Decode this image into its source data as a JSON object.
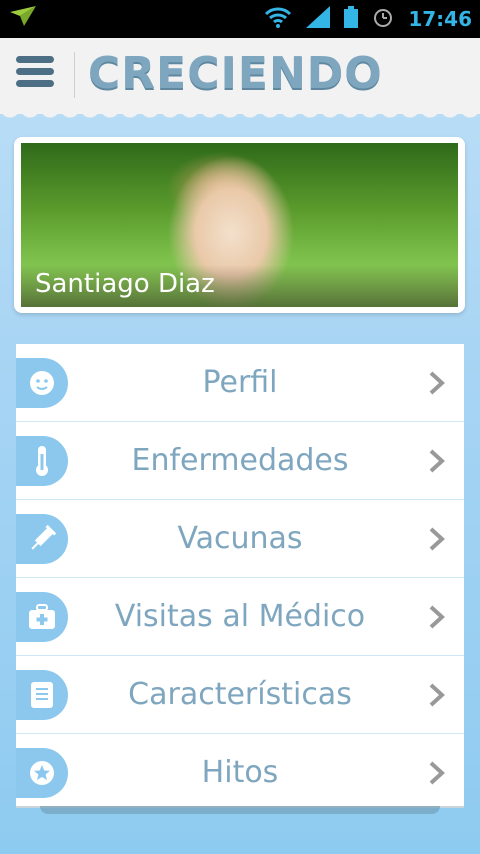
{
  "status_bar": {
    "time": "17:46"
  },
  "header": {
    "app_title": "CRECIENDO"
  },
  "profile": {
    "child_name": "Santiago Diaz"
  },
  "menu": {
    "items": [
      {
        "label": "Perfil",
        "icon": "face-icon"
      },
      {
        "label": "Enfermedades",
        "icon": "thermometer-icon"
      },
      {
        "label": "Vacunas",
        "icon": "syringe-icon"
      },
      {
        "label": "Visitas al Médico",
        "icon": "medical-kit-icon"
      },
      {
        "label": "Características",
        "icon": "notes-icon"
      },
      {
        "label": "Hitos",
        "icon": "star-icon"
      }
    ]
  },
  "colors": {
    "accent": "#8cc8ee",
    "title": "#7fa6bf",
    "status_time": "#33b5e5"
  }
}
